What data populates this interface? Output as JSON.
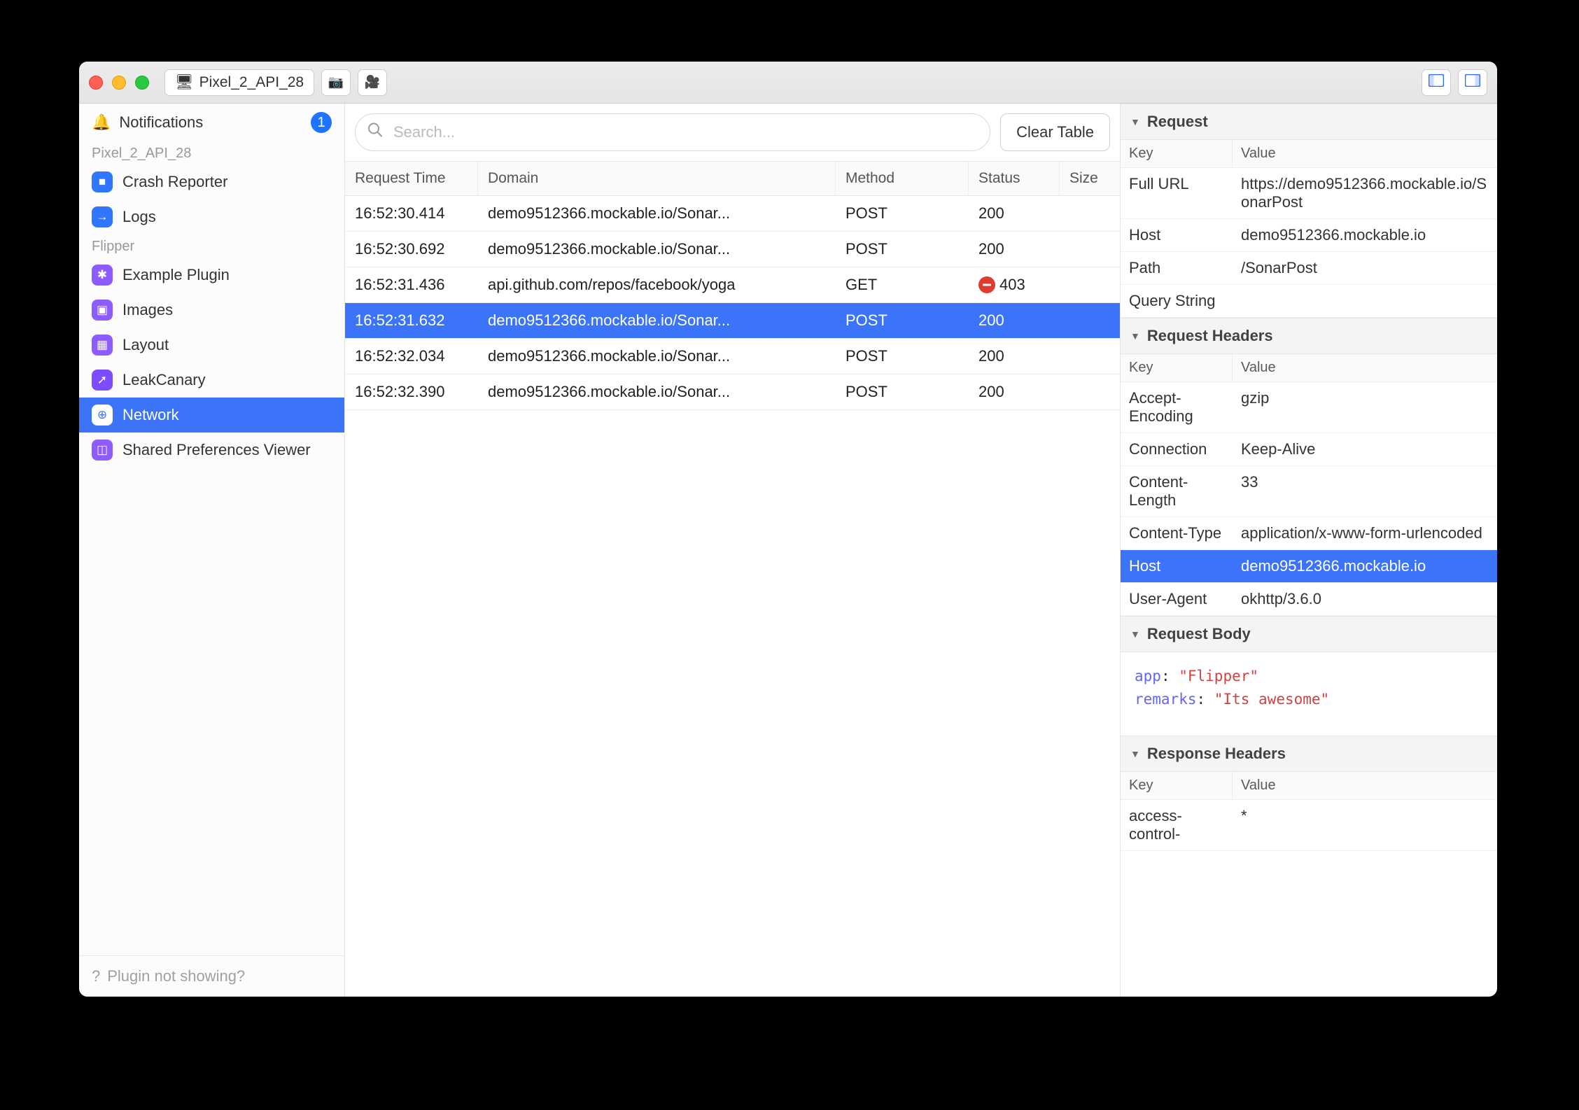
{
  "titlebar": {
    "device_chip": "Pixel_2_API_28"
  },
  "sidebar": {
    "notifications_label": "Notifications",
    "notifications_badge": "1",
    "groups": [
      {
        "label": "Pixel_2_API_28",
        "items": [
          {
            "label": "Crash Reporter",
            "icon_class": "ic-blue",
            "glyph": "■"
          },
          {
            "label": "Logs",
            "icon_class": "ic-blue",
            "glyph": "→"
          }
        ]
      },
      {
        "label": "Flipper",
        "items": [
          {
            "label": "Example Plugin",
            "icon_class": "ic-purple",
            "glyph": "✱"
          },
          {
            "label": "Images",
            "icon_class": "ic-purple",
            "glyph": "▣"
          },
          {
            "label": "Layout",
            "icon_class": "ic-purple",
            "glyph": "▦"
          },
          {
            "label": "LeakCanary",
            "icon_class": "ic-violet",
            "glyph": "➚"
          },
          {
            "label": "Network",
            "icon_class": "ic-purple",
            "glyph": "⊕",
            "active": true
          },
          {
            "label": "Shared Preferences Viewer",
            "icon_class": "ic-purple",
            "glyph": "◫"
          }
        ]
      }
    ],
    "footer": "Plugin not showing?"
  },
  "toolbar": {
    "search_placeholder": "Search...",
    "clear_label": "Clear Table"
  },
  "table": {
    "columns": {
      "time": "Request Time",
      "domain": "Domain",
      "method": "Method",
      "status": "Status",
      "size": "Size"
    },
    "rows": [
      {
        "time": "16:52:30.414",
        "domain": "demo9512366.mockable.io/Sonar...",
        "method": "POST",
        "status": "200",
        "error": false
      },
      {
        "time": "16:52:30.692",
        "domain": "demo9512366.mockable.io/Sonar...",
        "method": "POST",
        "status": "200",
        "error": false
      },
      {
        "time": "16:52:31.436",
        "domain": "api.github.com/repos/facebook/yoga",
        "method": "GET",
        "status": "403",
        "error": true
      },
      {
        "time": "16:52:31.632",
        "domain": "demo9512366.mockable.io/Sonar...",
        "method": "POST",
        "status": "200",
        "error": false,
        "selected": true
      },
      {
        "time": "16:52:32.034",
        "domain": "demo9512366.mockable.io/Sonar...",
        "method": "POST",
        "status": "200",
        "error": false
      },
      {
        "time": "16:52:32.390",
        "domain": "demo9512366.mockable.io/Sonar...",
        "method": "POST",
        "status": "200",
        "error": false
      }
    ]
  },
  "panel": {
    "request": {
      "title": "Request",
      "key_label": "Key",
      "value_label": "Value",
      "rows": [
        {
          "k": "Full URL",
          "v": "https://demo9512366.mockable.io/SonarPost"
        },
        {
          "k": "Host",
          "v": "demo9512366.mockable.io"
        },
        {
          "k": "Path",
          "v": "/SonarPost"
        },
        {
          "k": "Query String",
          "v": ""
        }
      ]
    },
    "request_headers": {
      "title": "Request Headers",
      "key_label": "Key",
      "value_label": "Value",
      "rows": [
        {
          "k": "Accept-Encoding",
          "v": "gzip"
        },
        {
          "k": "Connection",
          "v": "Keep-Alive"
        },
        {
          "k": "Content-Length",
          "v": "33"
        },
        {
          "k": "Content-Type",
          "v": "application/x-www-form-urlencoded"
        },
        {
          "k": "Host",
          "v": "demo9512366.mockable.io",
          "selected": true
        },
        {
          "k": "User-Agent",
          "v": "okhttp/3.6.0"
        }
      ]
    },
    "request_body": {
      "title": "Request Body",
      "entries": [
        {
          "key": "app",
          "value": "\"Flipper\""
        },
        {
          "key": "remarks",
          "value": "\"Its awesome\""
        }
      ]
    },
    "response_headers": {
      "title": "Response Headers",
      "key_label": "Key",
      "value_label": "Value",
      "rows": [
        {
          "k": "access-control-",
          "v": "*"
        }
      ]
    }
  }
}
